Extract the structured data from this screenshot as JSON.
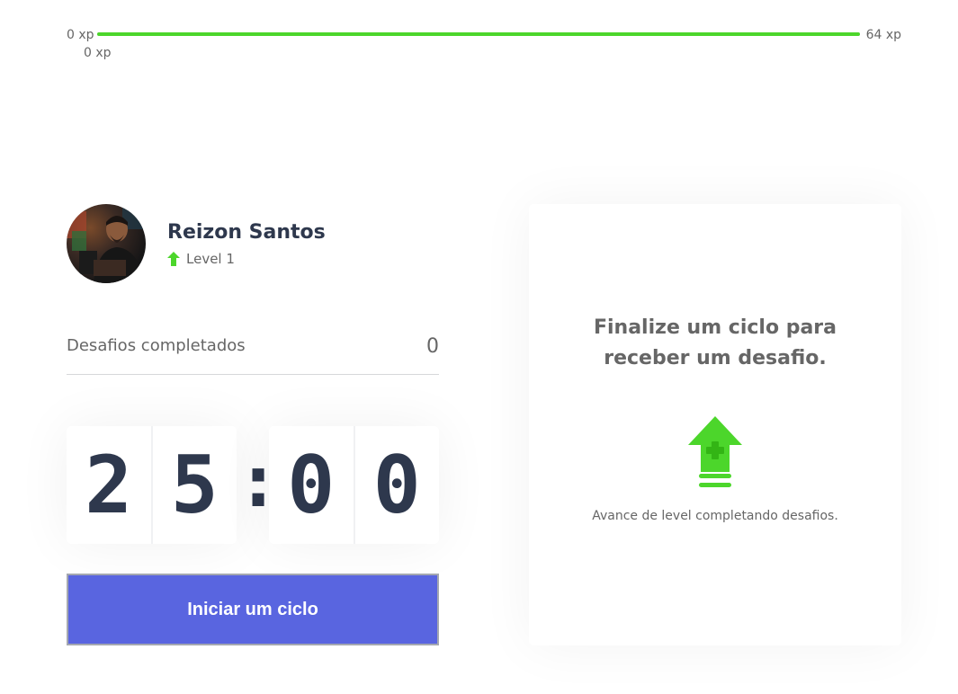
{
  "xp": {
    "min_label": "0 xp",
    "max_label": "64 xp",
    "current_label": "0 xp",
    "progress_fraction": 1.0,
    "bar_color": "#4cd62b"
  },
  "profile": {
    "name": "Reizon Santos",
    "level_label": "Level 1",
    "level_icon": "level-up-arrow-icon"
  },
  "challenges": {
    "completed_label": "Desafios completados",
    "completed_value": "0"
  },
  "countdown": {
    "minute_left": "2",
    "minute_right": "5",
    "separator": ":",
    "second_left": "0",
    "second_right": "0"
  },
  "actions": {
    "start_cycle_label": "Iniciar um ciclo",
    "button_color": "#5965e0"
  },
  "challenge_box": {
    "title": "Finalize um ciclo para receber um desafio.",
    "icon": "level-up-icon",
    "hint": "Avance de level completando desafios."
  }
}
